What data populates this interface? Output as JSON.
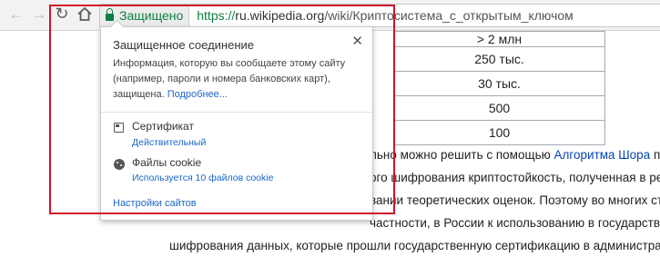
{
  "toolbar": {
    "back_icon": "arrow-left-icon",
    "forward_icon": "arrow-right-icon",
    "reload_icon": "reload-icon",
    "home_icon": "home-icon",
    "secure_label": "Защищено",
    "url_scheme": "https://",
    "url_host": "ru.wikipedia.org",
    "url_path": "/wiki/Криптосистема_с_открытым_ключом"
  },
  "table": {
    "rows": [
      "> 2 млн",
      "250 тыс.",
      "30 тыс.",
      "500",
      "100"
    ]
  },
  "article": {
    "line1_text": "льно можно решить с помощью ",
    "line1_link": "Алгоритма Шора",
    "line1_end": " при",
    "line2": "ого шифрования криптостойкость, полученная в резул",
    "line3": "вании теоретических оценок. Поэтому во многих стр",
    "line4": "частности, в России к использованию в государствен",
    "line5": "шифрования данных, которые прошли государственную сертификацию в администрати"
  },
  "popup": {
    "title": "Защищенное соединение",
    "close_icon": "close-icon",
    "description": "Информация, которую вы сообщаете этому сайту (например, пароли и номера банковских карт), защищена.",
    "more_link": "Подробнее...",
    "certificate_title": "Сертификат",
    "certificate_status": "Действительный",
    "cookies_title": "Файлы cookie",
    "cookies_status": "Используется 10 файлов cookie",
    "site_settings": "Настройки сайтов"
  },
  "colors": {
    "secure_green": "#0b8043",
    "link_blue": "#1a66c8",
    "highlight_red": "#d0142c"
  }
}
